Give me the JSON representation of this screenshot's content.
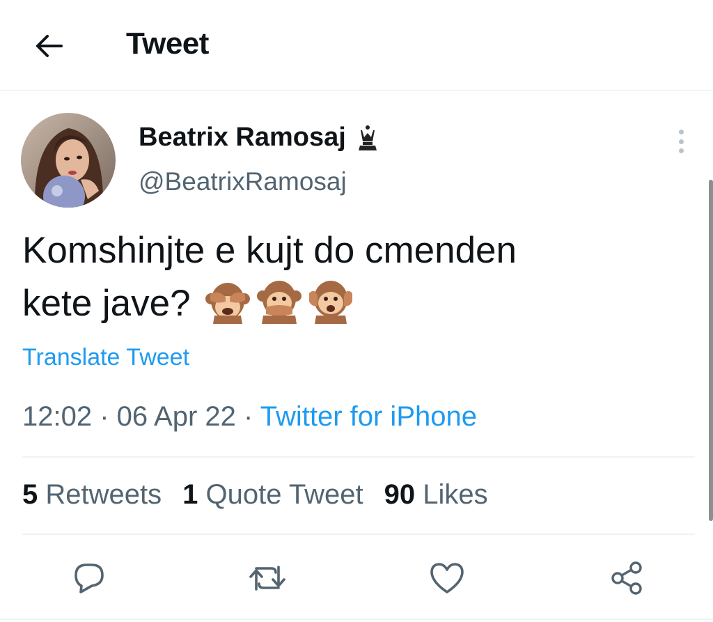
{
  "header": {
    "title": "Tweet",
    "back_icon": "arrow-left-icon"
  },
  "author": {
    "display_name": "Beatrix Ramosaj",
    "handle": "@BeatrixRamosaj",
    "badge_icon": "chess-queen-icon"
  },
  "tweet": {
    "text_line1": "Komshinjte e kujt do cmenden",
    "text_line2": "kete jave?",
    "emojis": [
      "see-no-evil-monkey",
      "speak-no-evil-monkey",
      "hear-no-evil-monkey"
    ],
    "translate_label": "Translate Tweet"
  },
  "meta": {
    "time": "12:02",
    "separator": " · ",
    "date": "06 Apr 22",
    "source": "Twitter for iPhone"
  },
  "stats": {
    "retweets_count": "5",
    "retweets_label": "Retweets",
    "quotes_count": "1",
    "quotes_label": "Quote Tweet",
    "likes_count": "90",
    "likes_label": "Likes"
  },
  "actions": [
    "reply-icon",
    "retweet-icon",
    "like-icon",
    "share-icon"
  ],
  "colors": {
    "accent": "#1d9bf0",
    "secondary_text": "#536471",
    "primary_text": "#0f1419",
    "divider": "#eff3f4"
  }
}
